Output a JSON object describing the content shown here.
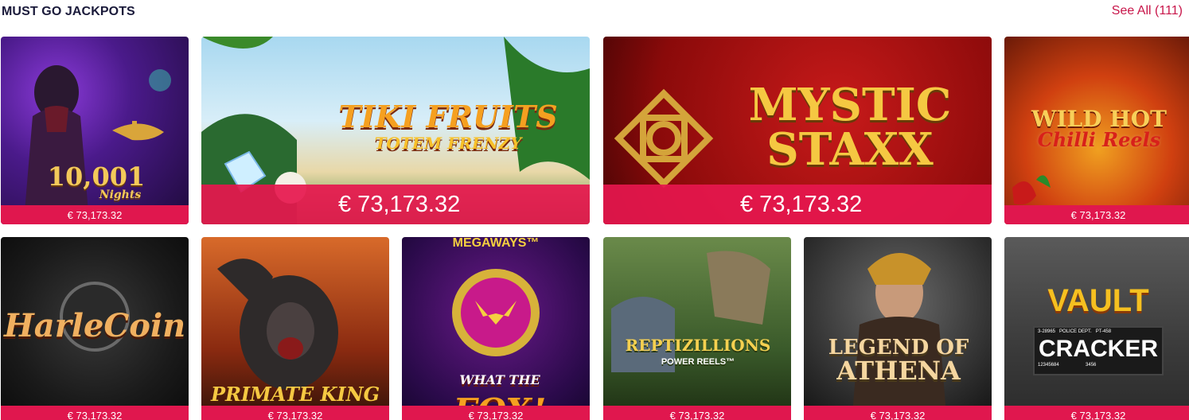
{
  "section": {
    "title": "MUST GO JACKPOTS",
    "see_all": "See All (111)"
  },
  "games_row1": [
    {
      "title_main": "10,001",
      "title_sub": "Nights",
      "jackpot": "€ 73,173.32"
    },
    {
      "title_main": "TIKI FRUITS",
      "title_sub": "TOTEM FRENZY",
      "jackpot": "€ 73,173.32"
    },
    {
      "title_main": "MYSTIC",
      "title_sub": "STAXX",
      "jackpot": "€ 73,173.32"
    },
    {
      "title_main": "WILD HOT",
      "title_sub": "Chilli Reels",
      "jackpot": "€ 73,173.32"
    }
  ],
  "games_row2": [
    {
      "title_main": "HarleCoin",
      "jackpot": "€ 73,173.32"
    },
    {
      "title_main": "PRIMATE KING",
      "jackpot": "€ 73,173.32"
    },
    {
      "title_top": "MEGAWAYS™",
      "title_main": "FOX!",
      "title_pre": "WHAT THE",
      "jackpot": "€ 73,173.32"
    },
    {
      "title_main": "REPTIZILLIONS",
      "title_sub": "POWER REELS™",
      "jackpot": "€ 73,173.32"
    },
    {
      "title_main": "LEGEND OF",
      "title_sub": "ATHENA",
      "jackpot": "€ 73,173.32"
    },
    {
      "title_main": "VAULT",
      "title_sub": "CRACKER",
      "plate_top": "3-28965   POLICE DEPT.   PT-458",
      "plate_bottom": "12345684                    3456",
      "jackpot": "€ 73,173.32"
    }
  ],
  "colors": {
    "accent": "#e0174e",
    "link": "#c8164a",
    "title": "#1a1a3a"
  }
}
